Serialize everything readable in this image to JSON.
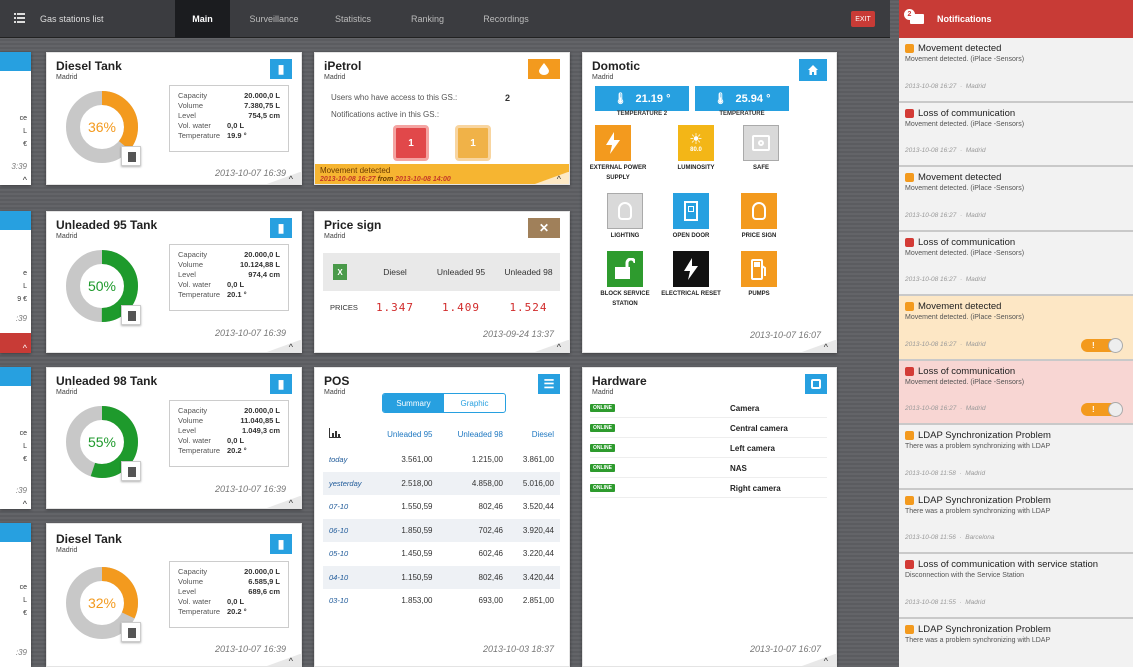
{
  "nav": {
    "gs_list": "Gas stations list",
    "tabs": [
      "Main",
      "Surveillance",
      "Statistics",
      "Ranking",
      "Recordings"
    ],
    "active_tab": "Main",
    "exit": "EXIT"
  },
  "edge_cards": [
    {
      "lines": [
        "ce",
        "L",
        "€"
      ],
      "date": "3:39",
      "arrow": "^"
    },
    {
      "lines": [
        "e",
        "L",
        "9 €"
      ],
      "date": ":39",
      "arrow": "^"
    },
    {
      "lines": [
        "ce",
        "L",
        "€"
      ],
      "date": ":39",
      "arrow": "^"
    },
    {
      "lines": [
        "ce",
        "L",
        "€"
      ],
      "date": ":39",
      "arrow": "^"
    }
  ],
  "tanks": [
    {
      "title": "Diesel Tank",
      "city": "Madrid",
      "percent": "36%",
      "fill": 0.36,
      "color": "#f39a1e",
      "capacity_label": "Capacity",
      "capacity": "20.000,0 L",
      "volume_label": "Volume",
      "volume": "7.380,75 L",
      "level_label": "Level",
      "level": "754,5 cm",
      "water_label": "Vol. water",
      "water": "0,0 L",
      "temp_label": "Temperature",
      "temp": "19.9 °",
      "date": "2013-10-07 16:39",
      "arrow": "^"
    },
    {
      "title": "Unleaded 95 Tank",
      "city": "Madrid",
      "percent": "50%",
      "fill": 0.5,
      "color": "#1e9a2c",
      "capacity_label": "Capacity",
      "capacity": "20.000,0 L",
      "volume_label": "Volume",
      "volume": "10.124,88 L",
      "level_label": "Level",
      "level": "974,4 cm",
      "water_label": "Vol. water",
      "water": "0,0 L",
      "temp_label": "Temperature",
      "temp": "20.1 °",
      "date": "2013-10-07 16:39",
      "arrow": "^"
    },
    {
      "title": "Unleaded 98 Tank",
      "city": "Madrid",
      "percent": "55%",
      "fill": 0.55,
      "color": "#1e9a2c",
      "capacity_label": "Capacity",
      "capacity": "20.000,0 L",
      "volume_label": "Volume",
      "volume": "11.040,85 L",
      "level_label": "Level",
      "level": "1.049,3 cm",
      "water_label": "Vol. water",
      "water": "0,0 L",
      "temp_label": "Temperature",
      "temp": "20.2 °",
      "date": "2013-10-07 16:39",
      "arrow": "^"
    },
    {
      "title": "Diesel Tank",
      "city": "Madrid",
      "percent": "32%",
      "fill": 0.32,
      "color": "#f39a1e",
      "capacity_label": "Capacity",
      "capacity": "20.000,0 L",
      "volume_label": "Volume",
      "volume": "6.585,9 L",
      "level_label": "Level",
      "level": "689,6 cm",
      "water_label": "Vol. water",
      "water": "0,0 L",
      "temp_label": "Temperature",
      "temp": "20.2 °",
      "date": "2013-10-07 16:39",
      "arrow": "^"
    }
  ],
  "ipetrol": {
    "title": "iPetrol",
    "city": "Madrid",
    "icon": "drop-icon",
    "users_label": "Users who have access to this GS.:",
    "users_value": "2",
    "notif_label": "Notifications active in this GS.:",
    "red_count": "1",
    "orange_count": "1",
    "alert_title": "Movement detected",
    "alert_time": "2013-10-08 16:27",
    "alert_from_label": "from",
    "alert_from": "2013-10-08 14:00",
    "arrow": "^"
  },
  "price_sign": {
    "title": "Price sign",
    "city": "Madrid",
    "icon": "tools-icon",
    "headers": [
      "Diesel",
      "Unleaded 95",
      "Unleaded 98"
    ],
    "row_label": "PRICES",
    "prices": [
      "1.347",
      "1.409",
      "1.524"
    ],
    "date": "2013-09-24 13:37",
    "arrow": "^"
  },
  "pos": {
    "title": "POS",
    "city": "Madrid",
    "icon": "list-icon",
    "seg": [
      "Summary",
      "Graphic"
    ],
    "headers": [
      "Unleaded 95",
      "Unleaded 98",
      "Diesel"
    ],
    "rows": [
      [
        "today",
        "3.561,00",
        "1.215,00",
        "3.861,00"
      ],
      [
        "yesterday",
        "2.518,00",
        "4.858,00",
        "5.016,00"
      ],
      [
        "07-10",
        "1.550,59",
        "802,46",
        "3.520,44"
      ],
      [
        "06-10",
        "1.850,59",
        "702,46",
        "3.920,44"
      ],
      [
        "05-10",
        "1.450,59",
        "602,46",
        "3.220,44"
      ],
      [
        "04-10",
        "1.150,59",
        "802,46",
        "3.420,44"
      ],
      [
        "03-10",
        "1.853,00",
        "693,00",
        "2.851,00"
      ]
    ],
    "date": "2013-10-03 18:37"
  },
  "domotic": {
    "title": "Domotic",
    "city": "Madrid",
    "icon": "home-icon",
    "sensors": [
      {
        "value": "21.19 °",
        "label": "TEMPERATURE 2"
      },
      {
        "value": "25.94 °",
        "label": "TEMPERATURE"
      }
    ],
    "luminosity_value": "80.0",
    "tiles": [
      {
        "label": "EXTERNAL POWER SUPPLY",
        "icon": "lightning-icon"
      },
      {
        "label": "LUMINOSITY",
        "icon": "sun-icon"
      },
      {
        "label": "SAFE",
        "icon": "safe-icon"
      },
      {
        "label": "LIGHTING",
        "icon": "bulb-icon"
      },
      {
        "label": "OPEN DOOR",
        "icon": "door-icon"
      },
      {
        "label": "PRICE SIGN",
        "icon": "bulb-icon"
      },
      {
        "label": "BLOCK SERVICE STATION",
        "icon": "unlock-icon"
      },
      {
        "label": "ELECTRICAL RESET",
        "icon": "lightning-icon"
      },
      {
        "label": "PUMPS",
        "icon": "pump-icon"
      }
    ],
    "date": "2013-10-07 16:07",
    "arrow": "^"
  },
  "hardware": {
    "title": "Hardware",
    "city": "Madrid",
    "icon": "chip-icon",
    "status": "ONLINE",
    "devices": [
      "Camera",
      "Central camera",
      "Left camera",
      "NAS",
      "Right camera"
    ],
    "date": "2013-10-07 16:07",
    "arrow": "^"
  },
  "notifications": {
    "header": "Notifications",
    "badge": "2",
    "items": [
      {
        "color": "#f39a1e",
        "title": "Movement detected",
        "desc": "Movement detected. (iPlace -Sensors)",
        "time": "2013-10-08 16:27",
        "place": "Madrid",
        "hl": ""
      },
      {
        "color": "#d33b36",
        "title": "Loss of communication",
        "desc": "Movement detected. (iPlace -Sensors)",
        "time": "2013-10-08 16:27",
        "place": "Madrid",
        "hl": ""
      },
      {
        "color": "#f39a1e",
        "title": "Movement detected",
        "desc": "Movement detected. (iPlace -Sensors)",
        "time": "2013-10-08 16:27",
        "place": "Madrid",
        "hl": ""
      },
      {
        "color": "#d33b36",
        "title": "Loss of communication",
        "desc": "Movement detected. (iPlace -Sensors)",
        "time": "2013-10-08 16:27",
        "place": "Madrid",
        "hl": ""
      },
      {
        "color": "#f39a1e",
        "title": "Movement detected",
        "desc": "Movement detected. (iPlace -Sensors)",
        "time": "2013-10-08 16:27",
        "place": "Madrid",
        "hl": "or",
        "toggle": "!"
      },
      {
        "color": "#d33b36",
        "title": "Loss of communication",
        "desc": "Movement detected. (iPlace -Sensors)",
        "time": "2013-10-08 16:27",
        "place": "Madrid",
        "hl": "red",
        "toggle": "!"
      },
      {
        "color": "#f39a1e",
        "title": "LDAP Synchronization Problem",
        "desc": "There was a problem synchronizing with LDAP",
        "time": "2013-10-08 11:58",
        "place": "Madrid",
        "hl": ""
      },
      {
        "color": "#f39a1e",
        "title": "LDAP Synchronization Problem",
        "desc": "There was a problem synchronizing with LDAP",
        "time": "2013-10-08 11:56",
        "place": "Barcelona",
        "hl": ""
      },
      {
        "color": "#d33b36",
        "title": "Loss of communication with service station",
        "desc": "Disconnection with the Service Station",
        "time": "2013-10-08 11:55",
        "place": "Madrid",
        "hl": ""
      },
      {
        "color": "#f39a1e",
        "title": "LDAP Synchronization Problem",
        "desc": "There was a problem synchronizing with LDAP",
        "time": "",
        "place": "",
        "hl": ""
      }
    ]
  }
}
